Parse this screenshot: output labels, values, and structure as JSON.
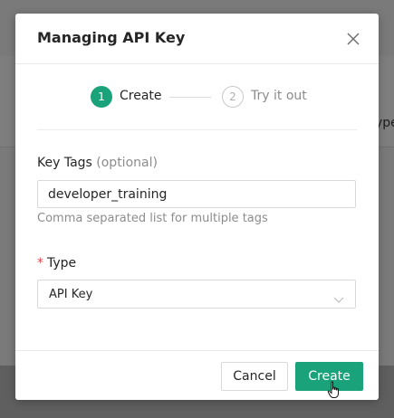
{
  "modal": {
    "title": "Managing API Key",
    "close_icon": "close-icon"
  },
  "steps": [
    {
      "number": "1",
      "label": "Create",
      "state": "active"
    },
    {
      "number": "2",
      "label": "Try it out",
      "state": "pending"
    }
  ],
  "form": {
    "key_tags": {
      "label": "Key Tags",
      "optional_suffix": "(optional)",
      "value": "developer_training",
      "help": "Comma separated list for multiple tags"
    },
    "type": {
      "required_mark": "*",
      "label": "Type",
      "selected": "API Key",
      "arrow_icon": "chevron-down-icon"
    }
  },
  "footer": {
    "cancel_label": "Cancel",
    "create_label": "Create"
  },
  "background": {
    "partial_text": "ype"
  },
  "colors": {
    "accent": "#1aa37a",
    "required": "#e5484d"
  }
}
